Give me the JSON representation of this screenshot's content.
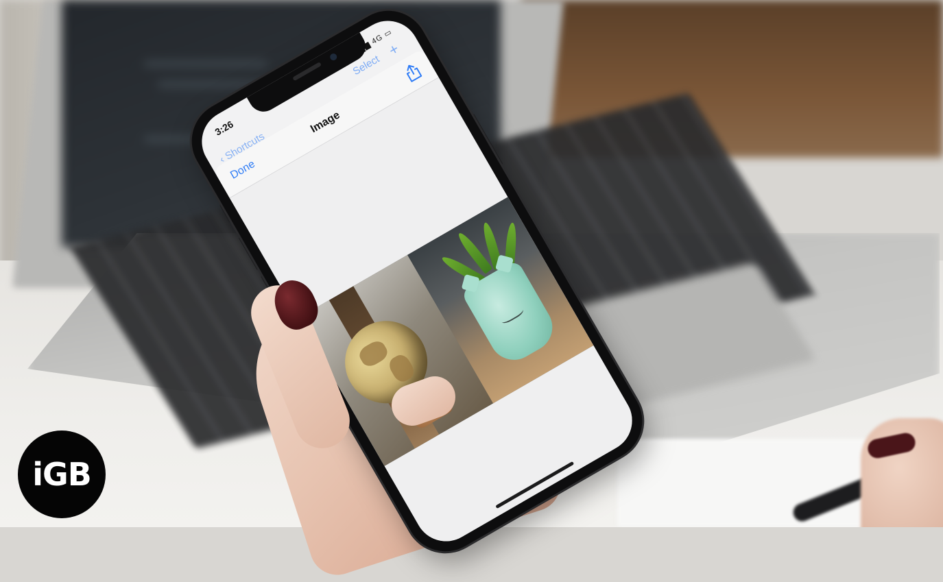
{
  "phone": {
    "status": {
      "time": "3:26",
      "network": "4G"
    },
    "back_layer": {
      "back_label": "Shortcuts",
      "select_label": "Select",
      "add_label": "+"
    },
    "nav": {
      "done_label": "Done",
      "title": "Image"
    }
  },
  "logo": {
    "text": "iGB"
  },
  "colors": {
    "ios_blue": "#2f7cf6",
    "nail": "#4a1519",
    "logo_bg": "#050505"
  }
}
